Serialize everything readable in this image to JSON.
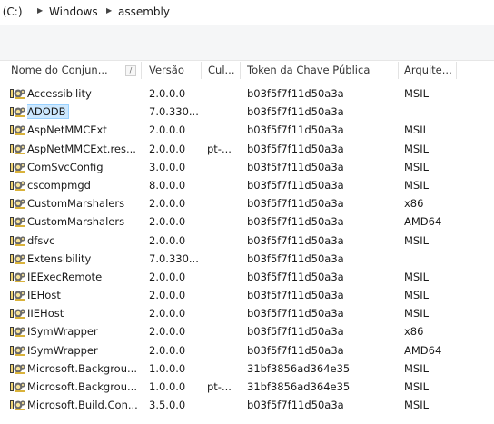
{
  "breadcrumb": {
    "items": [
      "r (C:)",
      "Windows",
      "assembly"
    ]
  },
  "columns": [
    "Nome do Conjun...",
    "Versão",
    "Cul...",
    "Token da Chave Pública",
    "Arquite..."
  ],
  "sort_indicator": "/",
  "icon": "assembly-gears-icon",
  "colors": {
    "selection_bg": "#cce8ff",
    "selection_border": "#99d1ff"
  },
  "rows": [
    {
      "name": "Accessibility",
      "version": "2.0.0.0",
      "culture": "",
      "token": "b03f5f7f11d50a3a",
      "arch": "MSIL"
    },
    {
      "name": "ADODB",
      "version": "7.0.330...",
      "culture": "",
      "token": "b03f5f7f11d50a3a",
      "arch": "",
      "selected": true
    },
    {
      "name": "AspNetMMCExt",
      "version": "2.0.0.0",
      "culture": "",
      "token": "b03f5f7f11d50a3a",
      "arch": "MSIL"
    },
    {
      "name": "AspNetMMCExt.res...",
      "version": "2.0.0.0",
      "culture": "pt-...",
      "token": "b03f5f7f11d50a3a",
      "arch": "MSIL"
    },
    {
      "name": "ComSvcConfig",
      "version": "3.0.0.0",
      "culture": "",
      "token": "b03f5f7f11d50a3a",
      "arch": "MSIL"
    },
    {
      "name": "cscompmgd",
      "version": "8.0.0.0",
      "culture": "",
      "token": "b03f5f7f11d50a3a",
      "arch": "MSIL"
    },
    {
      "name": "CustomMarshalers",
      "version": "2.0.0.0",
      "culture": "",
      "token": "b03f5f7f11d50a3a",
      "arch": "x86"
    },
    {
      "name": "CustomMarshalers",
      "version": "2.0.0.0",
      "culture": "",
      "token": "b03f5f7f11d50a3a",
      "arch": "AMD64"
    },
    {
      "name": "dfsvc",
      "version": "2.0.0.0",
      "culture": "",
      "token": "b03f5f7f11d50a3a",
      "arch": "MSIL"
    },
    {
      "name": "Extensibility",
      "version": "7.0.330...",
      "culture": "",
      "token": "b03f5f7f11d50a3a",
      "arch": ""
    },
    {
      "name": "IEExecRemote",
      "version": "2.0.0.0",
      "culture": "",
      "token": "b03f5f7f11d50a3a",
      "arch": "MSIL"
    },
    {
      "name": "IEHost",
      "version": "2.0.0.0",
      "culture": "",
      "token": "b03f5f7f11d50a3a",
      "arch": "MSIL"
    },
    {
      "name": "IIEHost",
      "version": "2.0.0.0",
      "culture": "",
      "token": "b03f5f7f11d50a3a",
      "arch": "MSIL"
    },
    {
      "name": "ISymWrapper",
      "version": "2.0.0.0",
      "culture": "",
      "token": "b03f5f7f11d50a3a",
      "arch": "x86"
    },
    {
      "name": "ISymWrapper",
      "version": "2.0.0.0",
      "culture": "",
      "token": "b03f5f7f11d50a3a",
      "arch": "AMD64"
    },
    {
      "name": "Microsoft.Backgrou...",
      "version": "1.0.0.0",
      "culture": "",
      "token": "31bf3856ad364e35",
      "arch": "MSIL"
    },
    {
      "name": "Microsoft.Backgrou...",
      "version": "1.0.0.0",
      "culture": "pt-...",
      "token": "31bf3856ad364e35",
      "arch": "MSIL"
    },
    {
      "name": "Microsoft.Build.Con...",
      "version": "3.5.0.0",
      "culture": "",
      "token": "b03f5f7f11d50a3a",
      "arch": "MSIL"
    }
  ]
}
